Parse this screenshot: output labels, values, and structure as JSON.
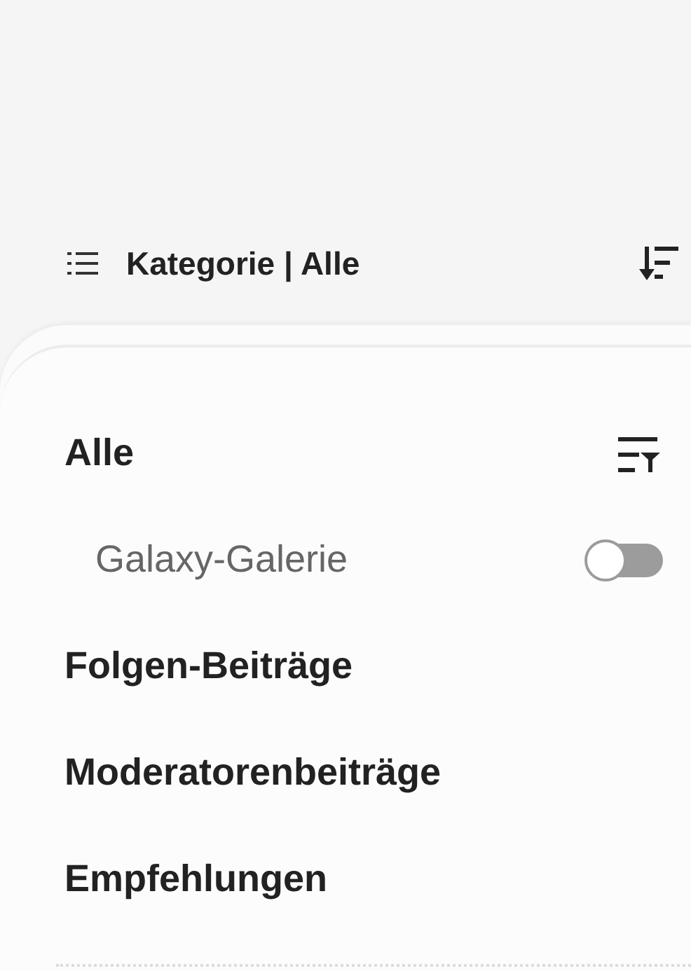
{
  "header": {
    "title": "Kategorie | Alle"
  },
  "items": [
    {
      "kind": "heading",
      "label": "Alle",
      "selected": true
    },
    {
      "kind": "toggle",
      "label": "Galaxy-Galerie",
      "on": false
    },
    {
      "kind": "link",
      "label": "Folgen-Beiträge"
    },
    {
      "kind": "link",
      "label": "Moderatorenbeiträge"
    },
    {
      "kind": "link",
      "label": "Empfehlungen"
    }
  ]
}
